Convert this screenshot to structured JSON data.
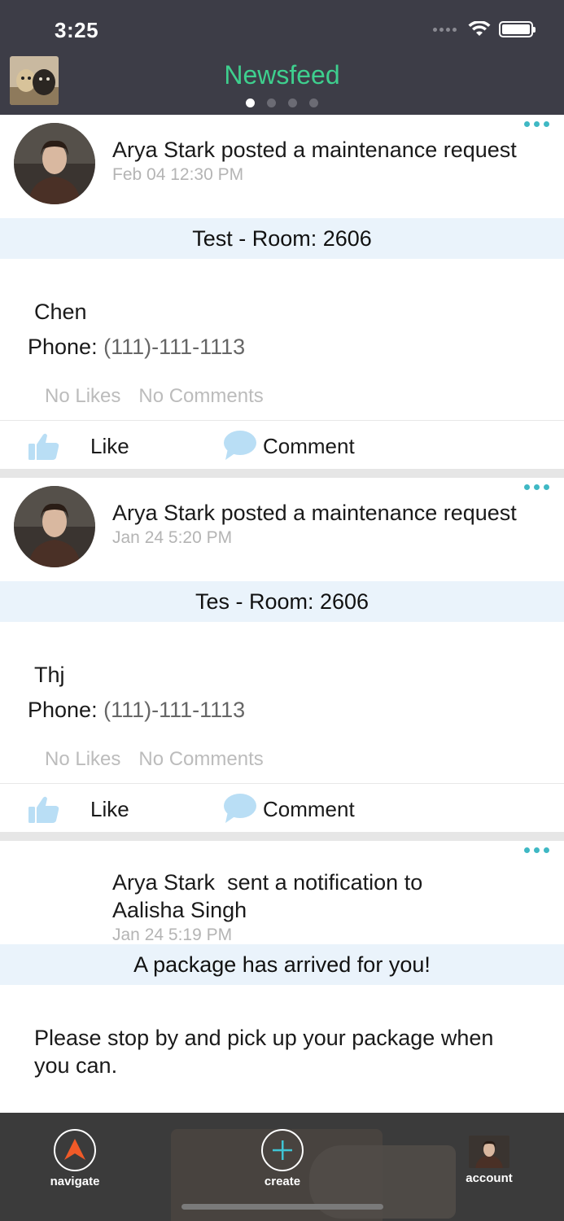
{
  "status_bar": {
    "time": "3:25"
  },
  "header": {
    "title": "Newsfeed",
    "page_count": 4,
    "active_page": 0
  },
  "colors": {
    "accent_green": "#3ecf8e",
    "header_bg": "#3d3d47",
    "more_dots": "#3fb8c4",
    "subject_bg": "#eaf3fb",
    "action_icon": "#b9def5"
  },
  "posts": [
    {
      "author": "Arya Stark",
      "action": "posted a maintenance request",
      "date": "Feb 04 12:30 PM",
      "subject": "Test - Room: 2606",
      "message": "Chen",
      "phone_label": "Phone:",
      "phone_value": "(111)-111-1113",
      "likes": "No Likes",
      "comments": "No Comments",
      "like_label": "Like",
      "comment_label": "Comment"
    },
    {
      "author": "Arya Stark",
      "action": "posted a maintenance request",
      "date": "Jan 24  5:20 PM",
      "subject": "Tes - Room: 2606",
      "message": "Thj",
      "phone_label": "Phone:",
      "phone_value": "(111)-111-1113",
      "likes": "No Likes",
      "comments": "No Comments",
      "like_label": "Like",
      "comment_label": "Comment"
    },
    {
      "author": "Arya Stark",
      "action": "sent a notification to",
      "recipient": "Aalisha Singh",
      "date": "Jan 24  5:19 PM",
      "subject": "A package has arrived for you!",
      "message": "Please stop by and pick up your package when you can."
    }
  ],
  "tabbar": {
    "navigate": "navigate",
    "create": "create",
    "account": "account"
  }
}
